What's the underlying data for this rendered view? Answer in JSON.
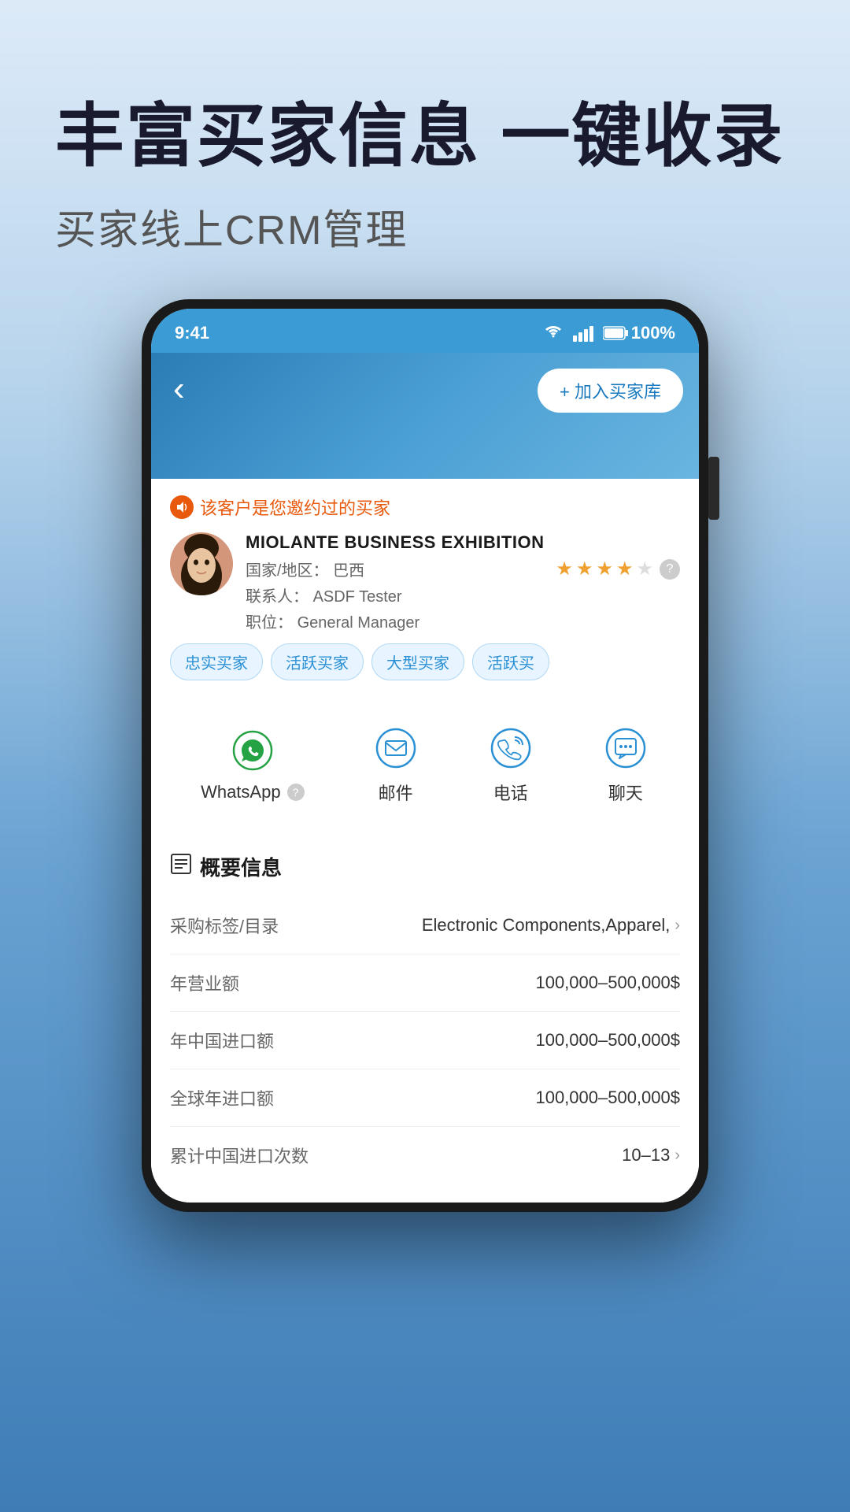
{
  "page": {
    "background_gradient": "linear-gradient(180deg, #ddeaf5 0%, #b8d4eb 30%, #7aaed6 60%, #4a8ec2 100%)"
  },
  "header": {
    "main_title": "丰富买家信息 一键收录",
    "sub_title": "买家线上CRM管理"
  },
  "phone": {
    "status_bar": {
      "time": "9:41",
      "battery": "100%"
    },
    "app_header": {
      "back_label": "‹",
      "add_button_label": "+ 加入买家库"
    },
    "customer_notice": {
      "text": "该客户是您邀约过的买家"
    },
    "customer": {
      "company_name": "MIOLANTE BUSINESS EXHIBITION",
      "country_label": "国家/地区：",
      "country_value": "巴西",
      "contact_label": "联系人：",
      "contact_value": "ASDF Tester",
      "position_label": "职位：",
      "position_value": "General Manager",
      "stars": [
        true,
        true,
        true,
        true,
        false
      ],
      "tags": [
        "忠实买家",
        "活跃买家",
        "大型买家",
        "活跃买"
      ]
    },
    "communication": {
      "items": [
        {
          "id": "whatsapp",
          "label": "WhatsApp",
          "has_question": true
        },
        {
          "id": "email",
          "label": "邮件",
          "has_question": false
        },
        {
          "id": "phone",
          "label": "电话",
          "has_question": false
        },
        {
          "id": "chat",
          "label": "聊天",
          "has_question": false
        }
      ]
    },
    "info_section": {
      "title": "概要信息",
      "items": [
        {
          "label": "采购标签/目录",
          "value": "Electronic Components,Apparel,",
          "has_arrow": true
        },
        {
          "label": "年营业额",
          "value": "100,000–500,000$",
          "has_arrow": false
        },
        {
          "label": "年中国进口额",
          "value": "100,000–500,000$",
          "has_arrow": false
        },
        {
          "label": "全球年进口额",
          "value": "100,000–500,000$",
          "has_arrow": false
        },
        {
          "label": "累计中国进口次数",
          "value": "10–13",
          "has_arrow": true
        }
      ]
    }
  }
}
